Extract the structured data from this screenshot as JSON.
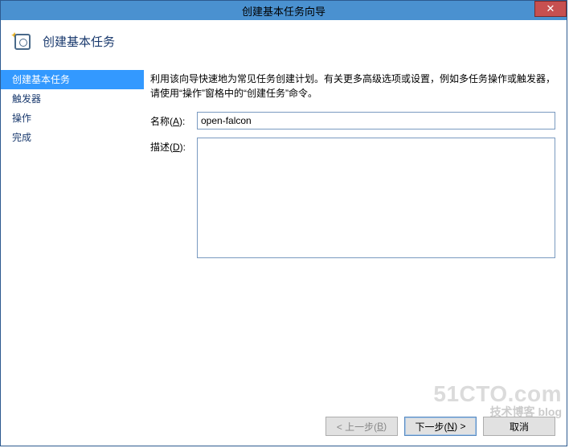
{
  "window": {
    "title": "创建基本任务向导",
    "close_glyph": "✕"
  },
  "header": {
    "title": "创建基本任务"
  },
  "sidebar": {
    "items": [
      {
        "label": "创建基本任务",
        "active": true
      },
      {
        "label": "触发器",
        "active": false
      },
      {
        "label": "操作",
        "active": false
      },
      {
        "label": "完成",
        "active": false
      }
    ]
  },
  "main": {
    "intro": "利用该向导快速地为常见任务创建计划。有关更多高级选项或设置，例如多任务操作或触发器，请使用“操作”窗格中的“创建任务”命令。",
    "name_label_pre": "名称(",
    "name_label_key": "A",
    "name_label_post": "):",
    "name_value": "open-falcon",
    "desc_label_pre": "描述(",
    "desc_label_key": "D",
    "desc_label_post": "):",
    "desc_value": ""
  },
  "footer": {
    "back_pre": "< 上一步(",
    "back_key": "B",
    "back_post": ")",
    "next_pre": "下一步(",
    "next_key": "N",
    "next_post": ") >",
    "cancel": "取消"
  },
  "watermark": {
    "big": "51CTO.com",
    "small": "技术博客 blog"
  }
}
